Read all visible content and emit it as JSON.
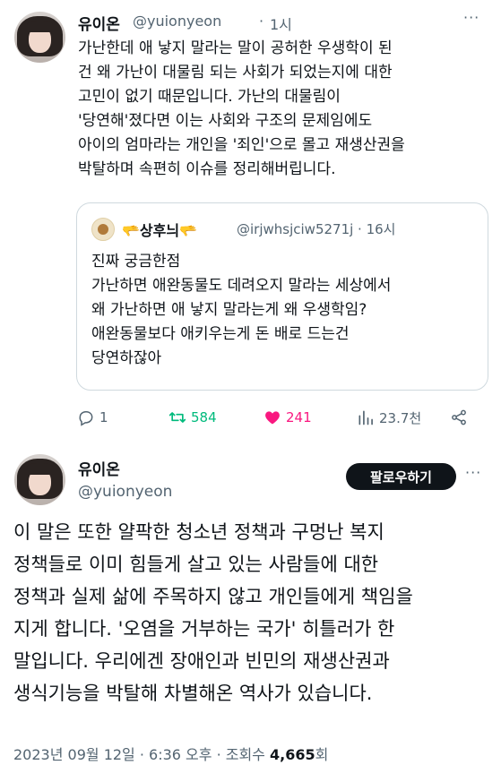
{
  "tweet1": {
    "name": "유이온",
    "handle": "@yuionyeon",
    "time_sep": "·",
    "time": "1시",
    "more": "···",
    "lines": [
      "가난한데 애 낳지 말라는 말이 공허한 우생학이 된",
      "건 왜 가난이 대물림 되는 사회가 되었는지에 대한",
      "고민이 없기 때문입니다. 가난의 대물림이",
      "'당연해'졌다면 이는 사회와 구조의 문제임에도",
      "아이의 엄마라는 개인을 '죄인'으로 몰고 재생산권을",
      "박탈하며 속편히 이슈를 정리해버립니다."
    ],
    "quote": {
      "name": "🫳상후늬🫳",
      "handle_time": "@irjwhsjciw5271j · 16시",
      "lines": [
        "진짜 궁금한점",
        "가난하면 애완동물도 데려오지 말라는 세상에서",
        "왜 가난하면 애 낳지 말라는게 왜 우생학임?",
        "애완동물보다 애키우는게 돈 배로 드는건",
        "당연하잖아"
      ]
    },
    "actions": {
      "replies": "1",
      "retweets": "584",
      "likes": "241",
      "views": "23.7천"
    }
  },
  "tweet2": {
    "name": "유이온",
    "handle": "@yuionyeon",
    "follow_label": "팔로우하기",
    "more": "···",
    "lines": [
      "이 말은 또한 얄팍한 청소년 정책과 구멍난 복지",
      "정책들로 이미 힘들게 살고 있는 사람들에 대한",
      "정책과 실제 삶에 주목하지 않고 개인들에게 책임을",
      "지게 합니다. '오염을 거부하는 국가' 히틀러가 한",
      "말입니다. 우리에겐 장애인과 빈민의 재생산권과",
      "생식기능을 박탈해 차별해온 역사가 있습니다."
    ],
    "meta": {
      "date": "2023년 09월 12일 · 6:36 오후 · 조회수",
      "views": "4,665",
      "views_suffix": "회"
    }
  },
  "colors": {
    "text": "#0f1419",
    "secondary": "#536471",
    "retweet": "#00ba7c",
    "like": "#f91880",
    "border": "#cfd9de"
  }
}
